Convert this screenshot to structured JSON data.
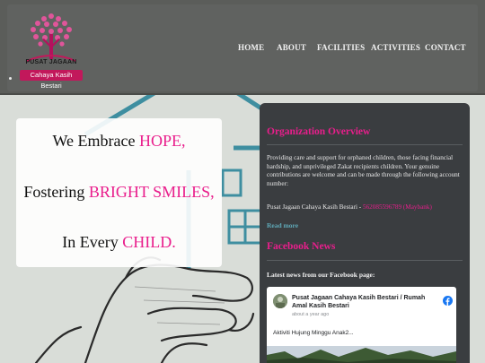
{
  "header": {
    "logo_title": "PUSAT JAGAAN",
    "logo_subtitle": "Cahaya Kasih Bestari",
    "nav": [
      {
        "label": "HOME"
      },
      {
        "label": "ABOUT"
      },
      {
        "label": "FACILITIES"
      },
      {
        "label": "ACTIVITIES"
      },
      {
        "label": "CONTACT"
      }
    ]
  },
  "hero": {
    "line1_prefix": "We Embrace ",
    "line1_highlight": "HOPE,",
    "line2_prefix": "Fostering ",
    "line2_highlight": "BRIGHT SMILES,",
    "line3_prefix": "In Every ",
    "line3_highlight": "CHILD."
  },
  "overview": {
    "heading": "Organization Overview",
    "body": "Providing care and support for orphaned children, those facing financial hardship, and unprivileged Zakat recipients children. Your genuine contributions are welcome and can be made through the following account number:",
    "account_name": "Pusat Jagaan Cahaya Kasih Bestari - ",
    "account_number": "562085596789 (Maybank)",
    "read_more": "Read more"
  },
  "facebook": {
    "heading": "Facebook News",
    "intro": "Latest news from our Facebook page:",
    "page_name": "Pusat Jagaan Cahaya Kasih Bestari / Rumah Amal Kasih Bestari",
    "time_ago": "about a year ago",
    "post_text": "Aktiviti Hujung Minggu Anak2..."
  },
  "colors": {
    "accent": "#e91e8c",
    "header_bg": "#5b5d5a",
    "panel_bg": "#3a3d40",
    "link": "#5fa9b8"
  }
}
